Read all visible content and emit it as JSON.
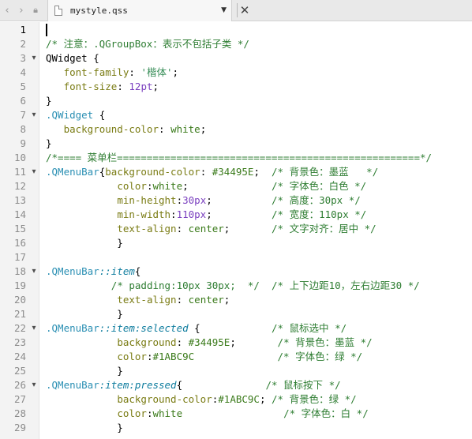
{
  "tab": {
    "title": "mystyle.qss",
    "nav_back_icon": "chevron-left-icon",
    "nav_forward_icon": "chevron-right-icon",
    "lock_icon": "lock-icon",
    "file_icon": "file-icon",
    "dropdown_icon": "chevron-down-icon",
    "close_icon": "close-icon"
  },
  "editor": {
    "active_line": 1,
    "lines": [
      {
        "n": "1",
        "fold": "",
        "segs": []
      },
      {
        "n": "2",
        "fold": "",
        "segs": [
          {
            "t": "/* 注意：.QGroupBox：表示不包括子类 */",
            "c": "c-cmt"
          }
        ]
      },
      {
        "n": "3",
        "fold": "▾",
        "segs": [
          {
            "t": "QWidget {",
            "c": "c-text"
          }
        ]
      },
      {
        "n": "4",
        "fold": "",
        "segs": [
          {
            "t": "   ",
            "c": "c-text"
          },
          {
            "t": "font-family",
            "c": "c-prop"
          },
          {
            "t": ": ",
            "c": "c-text"
          },
          {
            "t": "'楷体'",
            "c": "c-str"
          },
          {
            "t": ";",
            "c": "c-text"
          }
        ]
      },
      {
        "n": "5",
        "fold": "",
        "segs": [
          {
            "t": "   ",
            "c": "c-text"
          },
          {
            "t": "font-size",
            "c": "c-prop"
          },
          {
            "t": ": ",
            "c": "c-text"
          },
          {
            "t": "12",
            "c": "c-num"
          },
          {
            "t": "pt",
            "c": "c-unit"
          },
          {
            "t": ";",
            "c": "c-text"
          }
        ]
      },
      {
        "n": "6",
        "fold": "",
        "segs": [
          {
            "t": "}",
            "c": "c-text"
          }
        ]
      },
      {
        "n": "7",
        "fold": "▾",
        "segs": [
          {
            "t": ".QWidget",
            "c": "c-cls"
          },
          {
            "t": " {",
            "c": "c-text"
          }
        ]
      },
      {
        "n": "8",
        "fold": "",
        "segs": [
          {
            "t": "   ",
            "c": "c-text"
          },
          {
            "t": "background-color",
            "c": "c-prop"
          },
          {
            "t": ": ",
            "c": "c-text"
          },
          {
            "t": "white",
            "c": "c-val"
          },
          {
            "t": ";",
            "c": "c-text"
          }
        ]
      },
      {
        "n": "9",
        "fold": "",
        "segs": [
          {
            "t": "}",
            "c": "c-text"
          }
        ]
      },
      {
        "n": "10",
        "fold": "",
        "segs": [
          {
            "t": "/*==== 菜单栏===================================================*/",
            "c": "c-cmt"
          }
        ]
      },
      {
        "n": "11",
        "fold": "▾",
        "segs": [
          {
            "t": ".QMenuBar",
            "c": "c-cls"
          },
          {
            "t": "{",
            "c": "c-text"
          },
          {
            "t": "background-color",
            "c": "c-prop"
          },
          {
            "t": ": ",
            "c": "c-text"
          },
          {
            "t": "#34495E",
            "c": "c-val"
          },
          {
            "t": ";  ",
            "c": "c-text"
          },
          {
            "t": "/* 背景色：墨蓝   */",
            "c": "c-cmt"
          }
        ]
      },
      {
        "n": "12",
        "fold": "",
        "segs": [
          {
            "t": "            ",
            "c": "c-text"
          },
          {
            "t": "color",
            "c": "c-prop"
          },
          {
            "t": ":",
            "c": "c-text"
          },
          {
            "t": "white",
            "c": "c-val"
          },
          {
            "t": ";              ",
            "c": "c-text"
          },
          {
            "t": "/* 字体色：白色 */",
            "c": "c-cmt"
          }
        ]
      },
      {
        "n": "13",
        "fold": "",
        "segs": [
          {
            "t": "            ",
            "c": "c-text"
          },
          {
            "t": "min-height",
            "c": "c-prop"
          },
          {
            "t": ":",
            "c": "c-text"
          },
          {
            "t": "30",
            "c": "c-num"
          },
          {
            "t": "px",
            "c": "c-unit"
          },
          {
            "t": ";          ",
            "c": "c-text"
          },
          {
            "t": "/* 高度：30px */",
            "c": "c-cmt"
          }
        ]
      },
      {
        "n": "14",
        "fold": "",
        "segs": [
          {
            "t": "            ",
            "c": "c-text"
          },
          {
            "t": "min-width",
            "c": "c-prop"
          },
          {
            "t": ":",
            "c": "c-text"
          },
          {
            "t": "110",
            "c": "c-num"
          },
          {
            "t": "px",
            "c": "c-unit"
          },
          {
            "t": ";          ",
            "c": "c-text"
          },
          {
            "t": "/* 宽度：110px */",
            "c": "c-cmt"
          }
        ]
      },
      {
        "n": "15",
        "fold": "",
        "segs": [
          {
            "t": "            ",
            "c": "c-text"
          },
          {
            "t": "text-align",
            "c": "c-prop"
          },
          {
            "t": ": ",
            "c": "c-text"
          },
          {
            "t": "center",
            "c": "c-val"
          },
          {
            "t": ";       ",
            "c": "c-text"
          },
          {
            "t": "/* 文字对齐：居中 */",
            "c": "c-cmt"
          }
        ]
      },
      {
        "n": "16",
        "fold": "",
        "segs": [
          {
            "t": "            }",
            "c": "c-text"
          }
        ]
      },
      {
        "n": "17",
        "fold": "",
        "segs": []
      },
      {
        "n": "18",
        "fold": "▾",
        "segs": [
          {
            "t": ".QMenuBar",
            "c": "c-cls"
          },
          {
            "t": "::item",
            "c": "c-pseudo"
          },
          {
            "t": "{",
            "c": "c-text"
          }
        ]
      },
      {
        "n": "19",
        "fold": "",
        "segs": [
          {
            "t": "           ",
            "c": "c-text"
          },
          {
            "t": "/* padding:10px 30px;  */  /* 上下边距10，左右边距30 */",
            "c": "c-cmt"
          }
        ]
      },
      {
        "n": "20",
        "fold": "",
        "segs": [
          {
            "t": "            ",
            "c": "c-text"
          },
          {
            "t": "text-align",
            "c": "c-prop"
          },
          {
            "t": ": ",
            "c": "c-text"
          },
          {
            "t": "center",
            "c": "c-val"
          },
          {
            "t": ";",
            "c": "c-text"
          }
        ]
      },
      {
        "n": "21",
        "fold": "",
        "segs": [
          {
            "t": "            }",
            "c": "c-text"
          }
        ]
      },
      {
        "n": "22",
        "fold": "▾",
        "segs": [
          {
            "t": ".QMenuBar",
            "c": "c-cls"
          },
          {
            "t": "::item:selected",
            "c": "c-pseudo"
          },
          {
            "t": " {            ",
            "c": "c-text"
          },
          {
            "t": "/* 鼠标选中 */",
            "c": "c-cmt"
          }
        ]
      },
      {
        "n": "23",
        "fold": "",
        "segs": [
          {
            "t": "            ",
            "c": "c-text"
          },
          {
            "t": "background",
            "c": "c-prop"
          },
          {
            "t": ": ",
            "c": "c-text"
          },
          {
            "t": "#34495E",
            "c": "c-val"
          },
          {
            "t": ";       ",
            "c": "c-text"
          },
          {
            "t": "/* 背景色：墨蓝 */",
            "c": "c-cmt"
          }
        ]
      },
      {
        "n": "24",
        "fold": "",
        "segs": [
          {
            "t": "            ",
            "c": "c-text"
          },
          {
            "t": "color",
            "c": "c-prop"
          },
          {
            "t": ":",
            "c": "c-text"
          },
          {
            "t": "#1ABC9C",
            "c": "c-val"
          },
          {
            "t": "              ",
            "c": "c-text"
          },
          {
            "t": "/* 字体色：绿 */",
            "c": "c-cmt"
          }
        ]
      },
      {
        "n": "25",
        "fold": "",
        "segs": [
          {
            "t": "            }",
            "c": "c-text"
          }
        ]
      },
      {
        "n": "26",
        "fold": "▾",
        "segs": [
          {
            "t": ".QMenuBar",
            "c": "c-cls"
          },
          {
            "t": ":item:pressed",
            "c": "c-pseudo"
          },
          {
            "t": "{              ",
            "c": "c-text"
          },
          {
            "t": "/* 鼠标按下 */",
            "c": "c-cmt"
          }
        ]
      },
      {
        "n": "27",
        "fold": "",
        "segs": [
          {
            "t": "            ",
            "c": "c-text"
          },
          {
            "t": "background-color",
            "c": "c-prop"
          },
          {
            "t": ":",
            "c": "c-text"
          },
          {
            "t": "#1ABC9C",
            "c": "c-val"
          },
          {
            "t": "; ",
            "c": "c-text"
          },
          {
            "t": "/* 背景色：绿 */",
            "c": "c-cmt"
          }
        ]
      },
      {
        "n": "28",
        "fold": "",
        "segs": [
          {
            "t": "            ",
            "c": "c-text"
          },
          {
            "t": "color",
            "c": "c-prop"
          },
          {
            "t": ":",
            "c": "c-text"
          },
          {
            "t": "white",
            "c": "c-val"
          },
          {
            "t": "                 ",
            "c": "c-text"
          },
          {
            "t": "/* 字体色：白 */",
            "c": "c-cmt"
          }
        ]
      },
      {
        "n": "29",
        "fold": "",
        "segs": [
          {
            "t": "            }",
            "c": "c-text"
          }
        ]
      }
    ]
  }
}
